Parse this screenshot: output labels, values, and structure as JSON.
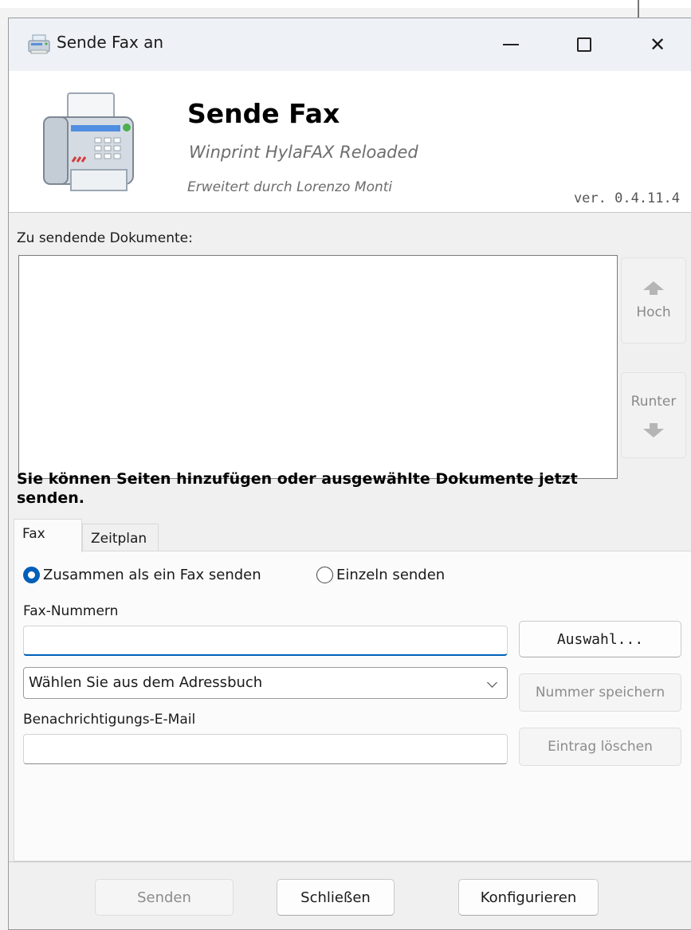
{
  "window": {
    "title": "Sende Fax an",
    "icon": "fax-small-icon",
    "controls": [
      "minimize-icon",
      "maximize-icon",
      "close-icon"
    ],
    "close_glyph": "✕"
  },
  "header": {
    "title": "Sende Fax",
    "subtitle": "Winprint HylaFAX Reloaded",
    "extended_by": "Erweitert durch Lorenzo Monti",
    "version": "ver. 0.4.11.4",
    "icon": "fax-machine-icon"
  },
  "documents": {
    "label": "Zu sendende Dokumente:",
    "items": [],
    "up_label": "Hoch",
    "down_label": "Runter"
  },
  "hint": "Sie können Seiten hinzufügen oder ausgewählte Dokumente jetzt senden.",
  "tabs": [
    {
      "label": "Fax",
      "active": true
    },
    {
      "label": "Zeitplan",
      "active": false
    }
  ],
  "fax_tab": {
    "radio_together": "Zusammen als ein Fax senden",
    "radio_single": "Einzeln senden",
    "selected_mode": "together",
    "fax_numbers_label": "Fax-Nummern",
    "fax_numbers_value": "",
    "select_button": "Auswahl...",
    "addressbook_value": "Wählen Sie aus dem Adressbuch",
    "save_number_button": "Nummer speichern",
    "email_label": "Benachrichtigungs-E-Mail",
    "email_value": "",
    "delete_entry_button": "Eintrag löschen"
  },
  "footer": {
    "send_button": "Senden",
    "close_button": "Schließen",
    "configure_button": "Konfigurieren"
  },
  "colors": {
    "accent": "#005fb8",
    "titlebar": "#eef1f6",
    "disabled_text": "#8c8c8c"
  }
}
